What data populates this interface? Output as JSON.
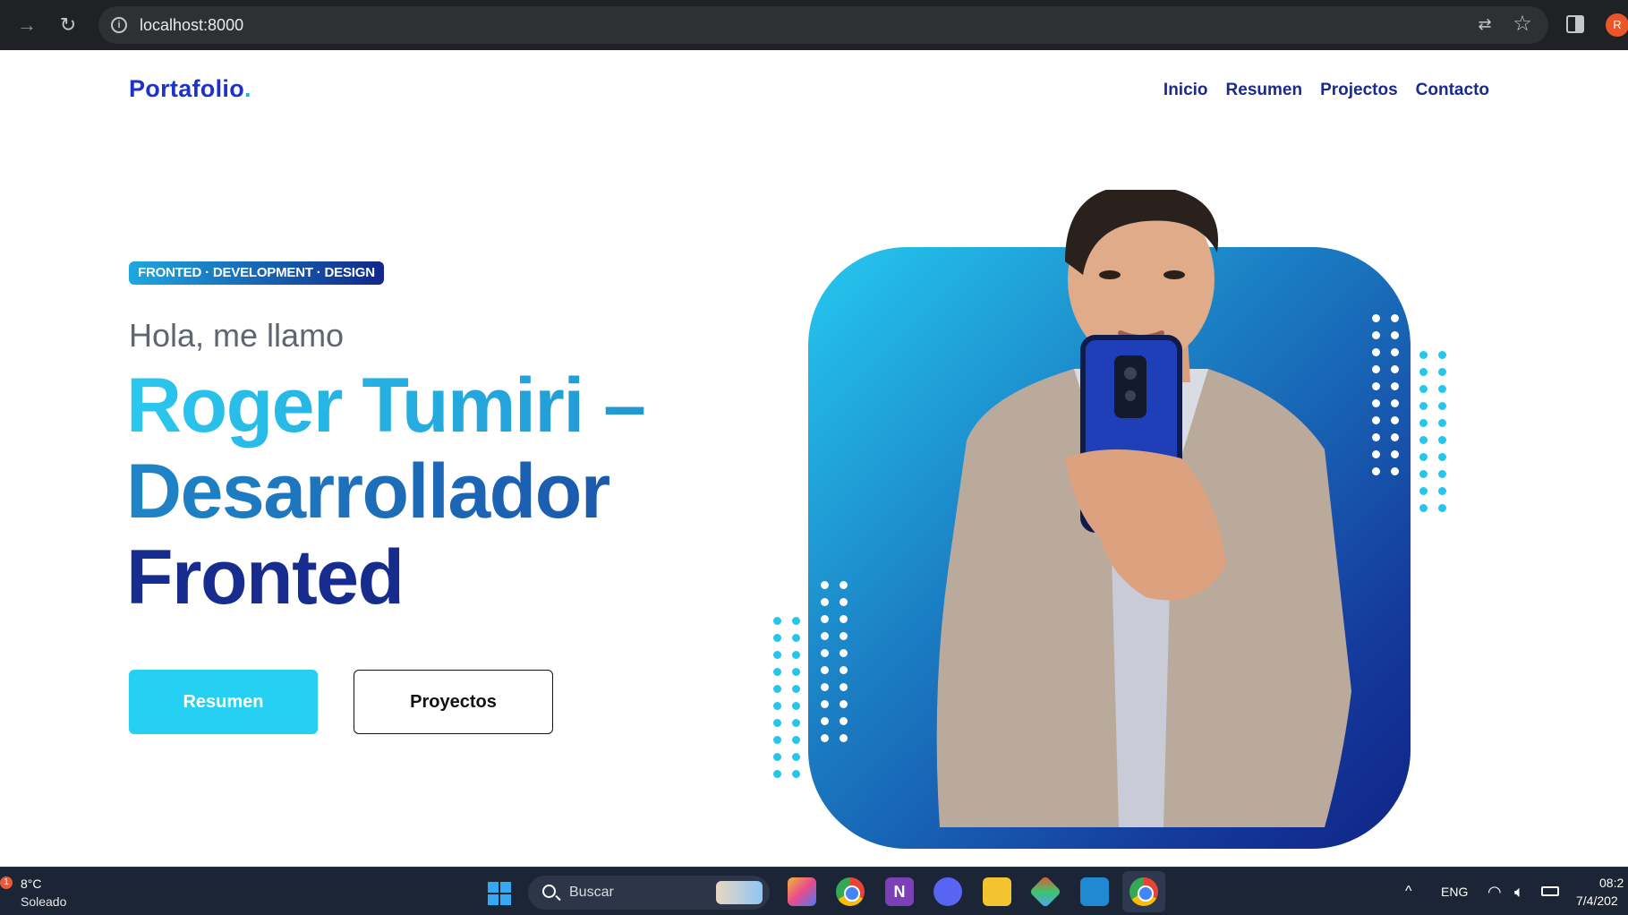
{
  "browser": {
    "url": "localhost:8000",
    "profile_initial": "R",
    "icons": [
      "forward-icon",
      "reload-icon",
      "site-info-icon",
      "translate-icon",
      "bookmark-star-icon",
      "side-panel-icon"
    ]
  },
  "site": {
    "logo": "Portafolio",
    "logo_dot": ".",
    "nav": [
      "Inicio",
      "Resumen",
      "Projectos",
      "Contacto"
    ]
  },
  "hero": {
    "tag": "FRONTED · DEVELOPMENT · DESIGN",
    "greeting": "Hola, me llamo",
    "title_line1": "Roger Tumiri –",
    "title_line2": "Desarrollador",
    "title_line3": "Fronted",
    "primary_button": "Resumen",
    "secondary_button": "Proyectos"
  },
  "colors": {
    "brand_blue": "#1b33c9",
    "accent_cyan": "#26d0f2",
    "navy": "#162b8b"
  },
  "taskbar": {
    "weather_badge": "1",
    "temperature": "8°C",
    "condition": "Soleado",
    "search_placeholder": "Buscar",
    "language": "ENG",
    "time": "08:2",
    "date": "7/4/202",
    "chevron": "^"
  }
}
